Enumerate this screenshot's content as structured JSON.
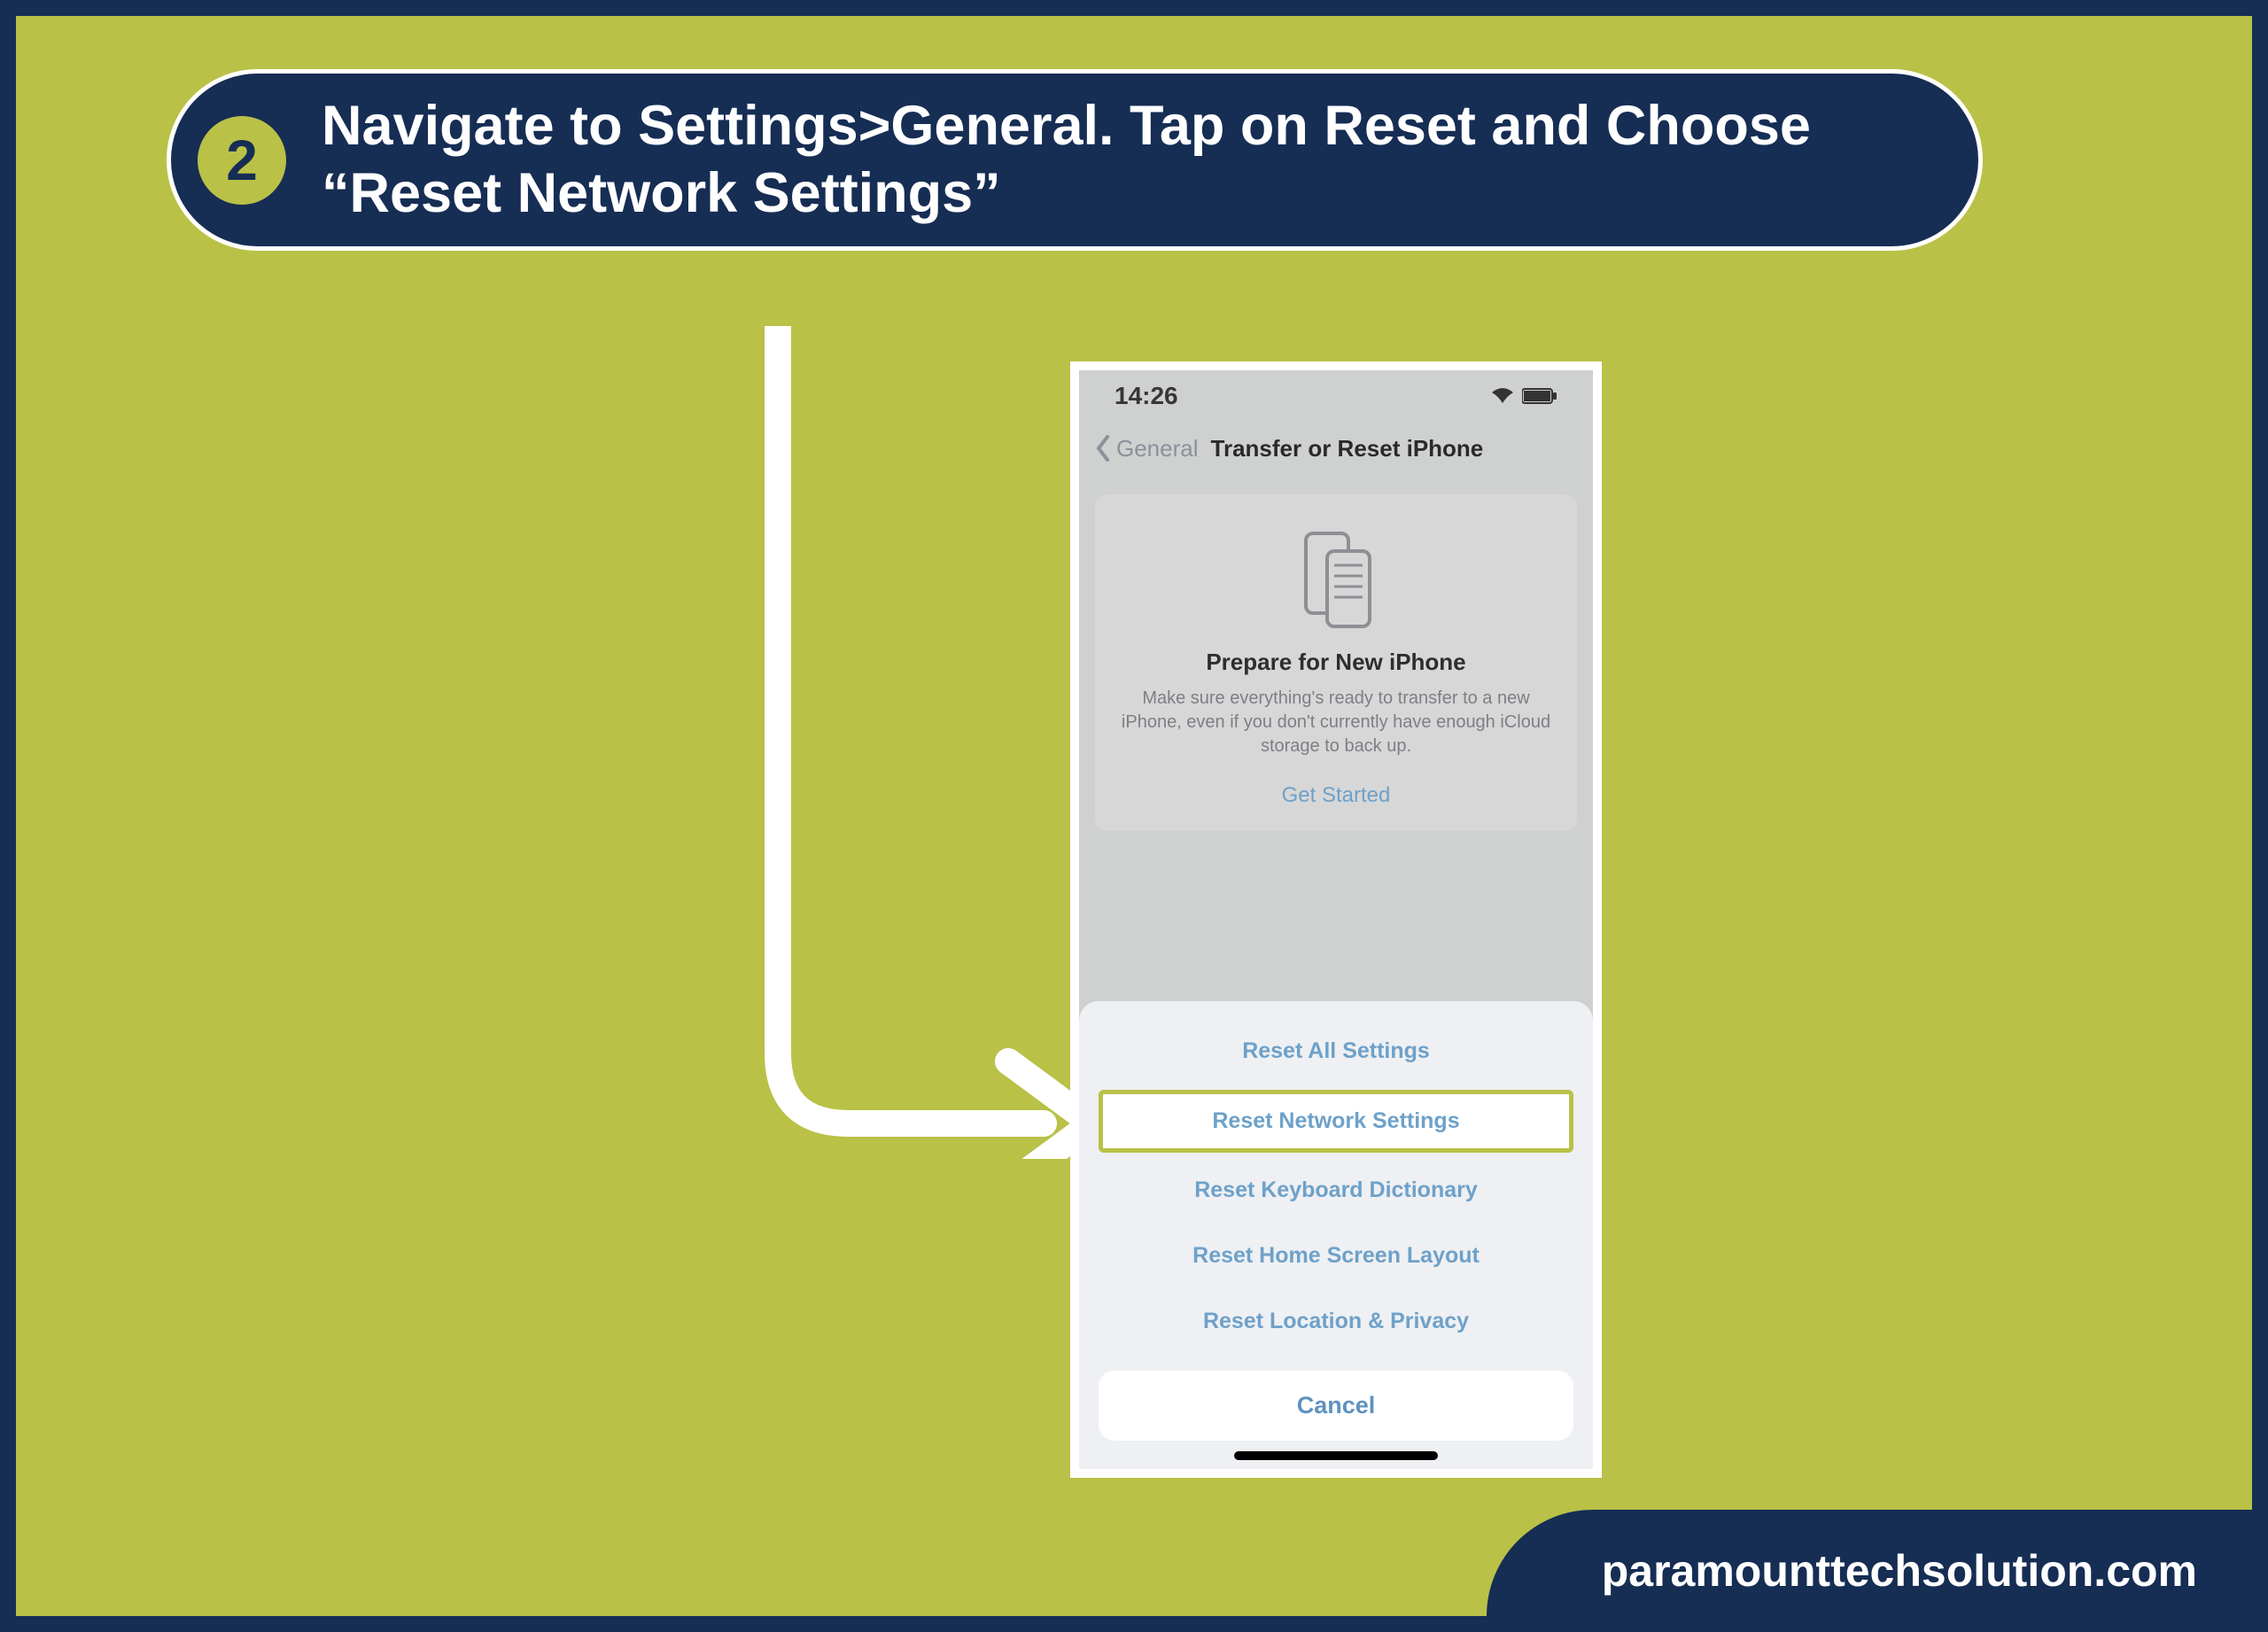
{
  "step": {
    "number": "2",
    "instruction": "Navigate to Settings>General. Tap on Reset and Choose “Reset Network Settings”"
  },
  "phone": {
    "status_time": "14:26",
    "nav_back": "General",
    "nav_title": "Transfer or Reset iPhone",
    "prepare": {
      "title": "Prepare for New iPhone",
      "desc": "Make sure everything's ready to transfer to a new iPhone, even if you don't currently have enough iCloud storage to back up.",
      "cta": "Get Started"
    },
    "sheet": {
      "items": [
        {
          "label": "Reset All Settings",
          "highlight": false
        },
        {
          "label": "Reset Network Settings",
          "highlight": true
        },
        {
          "label": "Reset Keyboard Dictionary",
          "highlight": false
        },
        {
          "label": "Reset Home Screen Layout",
          "highlight": false
        },
        {
          "label": "Reset Location & Privacy",
          "highlight": false
        }
      ],
      "cancel": "Cancel"
    }
  },
  "footer": {
    "domain": "paramounttechsolution.com"
  }
}
